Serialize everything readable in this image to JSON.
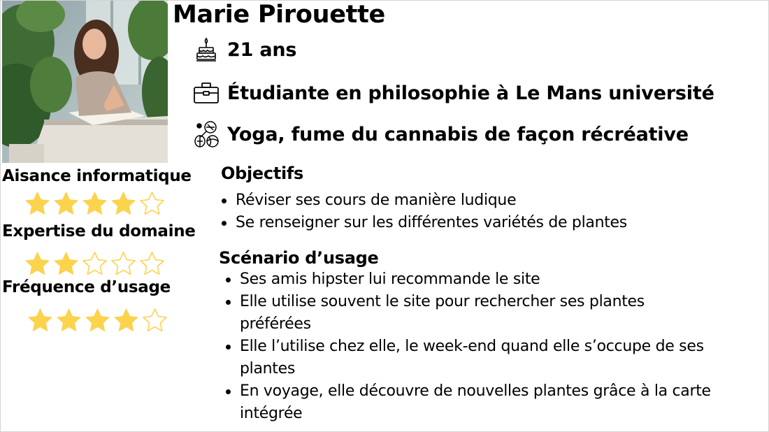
{
  "persona": {
    "name": "Marie Pirouette",
    "age": "21 ans",
    "occupation": "Étudiante en philosophie à Le Mans université",
    "hobbies": "Yoga, fume du cannabis de façon récréative"
  },
  "icons": {
    "age": "birthday-cake-icon",
    "occupation": "briefcase-icon",
    "hobbies": "sports-balls-icon"
  },
  "ratings": [
    {
      "label": "Aisance informatique",
      "value": 4,
      "max": 5
    },
    {
      "label": "Expertise du domaine",
      "value": 2,
      "max": 5
    },
    {
      "label": "Fréquence d’usage",
      "value": 4,
      "max": 5
    }
  ],
  "objectives": {
    "title": "Objectifs",
    "items": [
      "Réviser ses cours de manière ludique",
      "Se renseigner sur les différentes variétés de plantes"
    ]
  },
  "scenario": {
    "title": "Scénario d’usage",
    "items": [
      "Ses amis hipster lui recommande le site",
      "Elle utilise souvent le site pour rechercher ses plantes préférées",
      "Elle l’utilise chez elle, le week-end quand elle s’occupe de ses plantes",
      "En voyage, elle découvre de nouvelles plantes grâce à la carte intégrée"
    ]
  },
  "colors": {
    "star_fill": "#fcd34d",
    "star_empty_stroke": "#fcd34d",
    "text": "#000000"
  }
}
